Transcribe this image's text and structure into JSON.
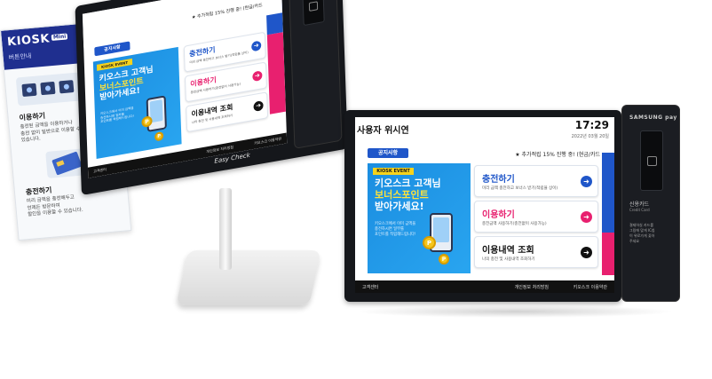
{
  "kiosk_screen": {
    "title": "사용자 위시연",
    "time": "17:29",
    "date": "2022년 03월 20일",
    "notice_label": "공지사항",
    "notice_text": "★ 추가적립 15% 진행 중! (현금/카드",
    "event": {
      "tag": "KIOSK EVENT",
      "title_line1": "키오스크 고객님",
      "title_line2": "보너스포인트",
      "title_line3": "받아가세요!",
      "desc_line1": "키오스크에서 이미 금액을",
      "desc_line2": "충전하시면 일부를",
      "desc_line3": "포인트를 적립해드립니다!"
    },
    "menu": [
      {
        "title": "충전하기",
        "desc": "미리 금액 충전하고 보너스 받기(적립율 상이)",
        "color": "#1f56c9",
        "icon": "arrow-right-icon"
      },
      {
        "title": "이용하기",
        "desc": "충전금액 사용하기(충전없이 사용가능)",
        "color": "#e8206f",
        "icon": "arrow-right-icon"
      },
      {
        "title": "이용내역 조회",
        "desc": "나의 충전 및 사용내역 조회하기",
        "color": "#111111",
        "icon": "arrow-right-icon"
      }
    ],
    "footer_left": "고객센터",
    "footer_right_1": "개인정보 처리방침",
    "footer_right_2": "키오스크 이용약관"
  },
  "card_reader": {
    "brand": "SAMSUNG pay",
    "label_title": "신용카드",
    "label_sub": "Credit Card",
    "hint_line1": "결제하실 카드를",
    "hint_line2": "그림에 맞게 IC칩",
    "hint_line3": "이 위로가게 꽂아",
    "hint_line4": "주세요"
  },
  "stand_brand": "Easy Check",
  "brochure": {
    "logo": "KIOSK",
    "logo_badge": "Mini",
    "subtitle": "버튼안내",
    "section1_title": "이용하기",
    "section1_desc": [
      "충전된 금액을 이용하거나",
      "충전 없이 일반으로 이용할 수",
      "있습니다."
    ],
    "section2_title": "충전하기",
    "section2_desc": [
      "미리 금액을 충전해두고",
      "언제든 방문하여",
      "할인을 이용할 수 있습니다."
    ]
  },
  "colors": {
    "blue": "#1f56c9",
    "pink": "#e8206f",
    "dark": "#111111"
  }
}
